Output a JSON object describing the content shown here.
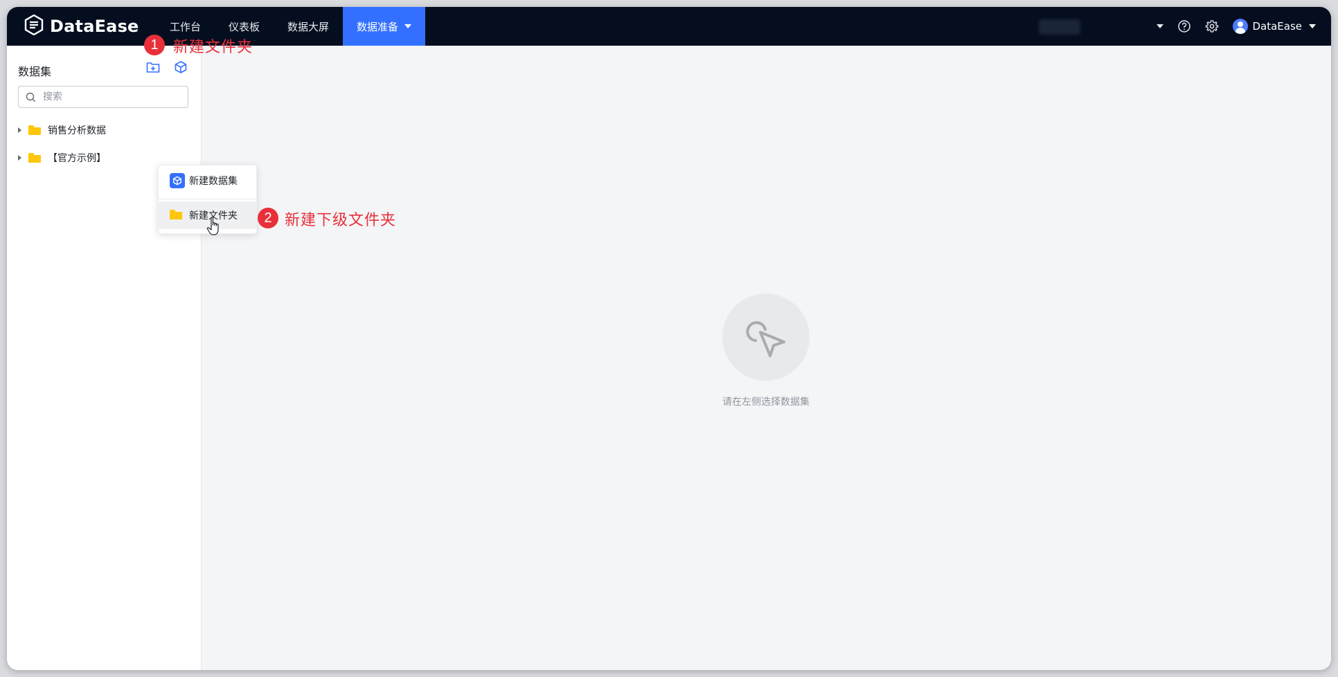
{
  "app": {
    "brand": "DataEase"
  },
  "nav": {
    "items": [
      {
        "label": "工作台"
      },
      {
        "label": "仪表板"
      },
      {
        "label": "数据大屏"
      },
      {
        "label": "数据准备",
        "active": true
      }
    ]
  },
  "header_right": {
    "user_name": "DataEase"
  },
  "sidebar": {
    "title": "数据集",
    "search_placeholder": "搜索",
    "tree": [
      {
        "label": "销售分析数据"
      },
      {
        "label": "【官方示例】"
      }
    ]
  },
  "context_menu": {
    "items": [
      {
        "label": "新建数据集"
      },
      {
        "label": "新建文件夹"
      }
    ]
  },
  "annotations": [
    {
      "number": "1",
      "text": "新建文件夹"
    },
    {
      "number": "2",
      "text": "新建下级文件夹"
    }
  ],
  "empty_state": {
    "text": "请在左侧选择数据集"
  },
  "colors": {
    "topbar_bg": "#050e1f",
    "accent": "#3370ff",
    "annotation_red": "#e8303a",
    "folder_yellow": "#ffc60a"
  }
}
